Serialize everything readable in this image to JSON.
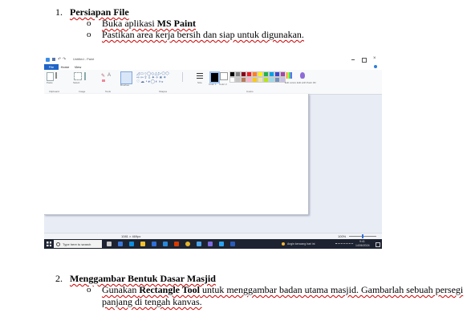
{
  "section1": {
    "number": "1.",
    "title": "Persiapan File",
    "bullet": "o",
    "items": [
      {
        "pre": "Buka aplikasi ",
        "bold": "MS Paint",
        "post": ""
      },
      {
        "pre": "Pastikan area kerja bersih dan siap untuk digunakan.",
        "bold": "",
        "post": ""
      }
    ]
  },
  "screenshot": {
    "window_title": "Untitled - Paint",
    "tabs": [
      "File",
      "Home",
      "View"
    ],
    "groups": [
      "Clipboard",
      "Image",
      "Tools",
      "Shapes",
      "Colors"
    ],
    "ribbon_labels": [
      "Paste",
      "Select",
      "Brushes",
      "Size",
      "Color 1",
      "Color 2",
      "Edit colors",
      "Edit with Paint 3D"
    ],
    "status_size": "1081 × 469px",
    "status_zoom": "100%",
    "search_placeholder": "Type here to search",
    "weather": "Angin kencang hari ini",
    "clock_time": "9:41",
    "clock_date": "14/06/2024",
    "palette": [
      "#000000",
      "#7f7f7f",
      "#880015",
      "#ed1c24",
      "#ff7f27",
      "#fff200",
      "#22b14c",
      "#00a2e8",
      "#3f48cc",
      "#a349a4",
      "#ffffff",
      "#c3c3c3",
      "#b97a57",
      "#ffaec9",
      "#ffc90e",
      "#efe4b0",
      "#b5e61d",
      "#99d9ea",
      "#7092be",
      "#c8bfe7"
    ],
    "taskbar_icons": [
      "windows-icon",
      "task-view-icon",
      "edge-icon",
      "explorer-icon",
      "store-icon",
      "mail-icon",
      "office-icon",
      "chrome-icon",
      "paint-icon",
      "photos-icon",
      "vscode-icon",
      "word-icon"
    ]
  },
  "section2": {
    "number": "2.",
    "title": "Menggambar Bentuk Dasar Masjid",
    "bullet": "o",
    "line1_pre": "Gunakan ",
    "line1_bold": "Rectangle Tool",
    "line1_post": " untuk menggambar badan utama masjid. Gambarlah sebuah persegi",
    "line2": "panjang di tengah kanvas."
  }
}
